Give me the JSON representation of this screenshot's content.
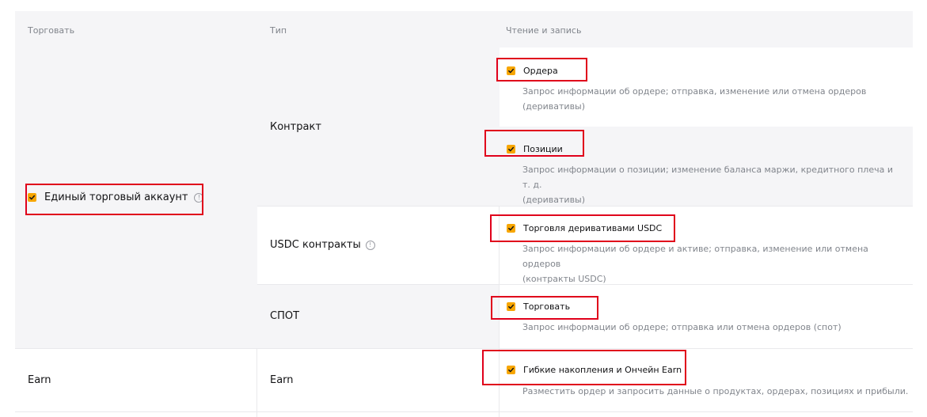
{
  "headers": {
    "trade": "Торговать",
    "type": "Тип",
    "readwrite": "Чтение и запись"
  },
  "account": {
    "label": "Единый торговый аккаунт",
    "checked": true
  },
  "types": {
    "contract": "Контракт",
    "usdc": "USDC контракты",
    "spot": "СПОТ",
    "earn": "Earn"
  },
  "earn_section": {
    "label": "Earn"
  },
  "permissions": {
    "orders": {
      "label": "Ордера",
      "desc_line1": "Запрос информации об ордере; отправка, изменение или отмена ордеров",
      "desc_line2": "(деривативы)",
      "checked": true
    },
    "positions": {
      "label": "Позиции",
      "desc_line1": "Запрос информации о позиции; изменение баланса маржи, кредитного плеча и т. д.",
      "desc_line2": "(деривативы)",
      "checked": true
    },
    "usdc_trading": {
      "label": "Торговля деривативами USDC",
      "desc_line1": "Запрос информации об ордере и активе; отправка, изменение или отмена ордеров",
      "desc_line2": "(контракты USDC)",
      "checked": true
    },
    "spot_trade": {
      "label": "Торговать",
      "desc_line1": "Запрос информации об ордере; отправка или отмена ордеров (спот)",
      "checked": true
    },
    "earn": {
      "label": "Гибкие накопления и Ончейн Earn",
      "desc_line1": "Разместить ордер и запросить данные о продуктах, ордерах, позициях и прибыли.",
      "checked": true
    }
  },
  "colors": {
    "checkbox": "#f7a600",
    "highlight": "#e0001b",
    "muted_text": "#81858c",
    "row_grey": "#f5f5f7"
  },
  "icons": {
    "info": "info-circle-icon",
    "check": "checkmark-icon"
  }
}
